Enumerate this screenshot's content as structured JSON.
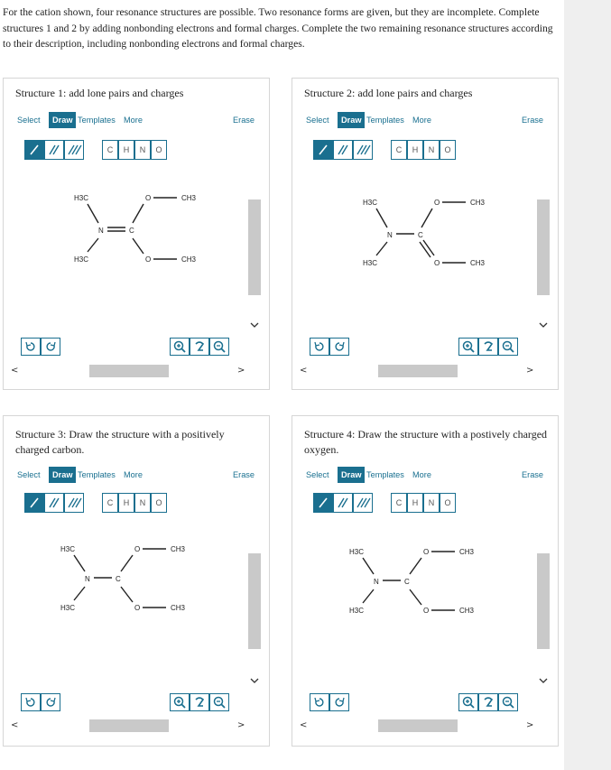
{
  "intro": "For the cation shown, four resonance structures are possible. Two resonance forms are given, but they are incomplete. Complete structures 1 and 2 by adding nonbonding electrons and formal charges. Complete the two remaining resonance structures according to their description, including nonbonding electrons and formal charges.",
  "toolbar": {
    "select": "Select",
    "draw": "Draw",
    "templates": "Templates",
    "more": "More",
    "erase": "Erase"
  },
  "atoms": [
    "C",
    "H",
    "N",
    "O"
  ],
  "labels": {
    "h3c": "H3C",
    "ch3": "CH3",
    "n": "N",
    "c": "C",
    "o": "O"
  },
  "panels": [
    {
      "title": "Structure 1: add lone pairs and charges",
      "structure": "cn-double"
    },
    {
      "title": "Structure 2: add lone pairs and charges",
      "structure": "co-double"
    },
    {
      "title": "Structure 3: Draw the structure with a positively charged carbon.",
      "structure": "single"
    },
    {
      "title": "Structure 4: Draw the structure with a postively charged oxygen.",
      "structure": "single"
    }
  ]
}
